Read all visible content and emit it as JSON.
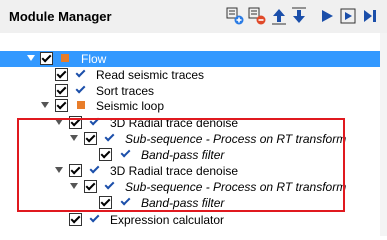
{
  "window": {
    "title": "Module Manager"
  },
  "toolbar": {
    "icons": [
      "add-module-icon",
      "remove-module-icon",
      "move-up-icon",
      "move-down-icon",
      "run-icon",
      "step-icon",
      "fast-forward-icon"
    ]
  },
  "tree": {
    "rows": [
      {
        "label": "Flow",
        "selected": true
      },
      {
        "label": "Read seismic traces"
      },
      {
        "label": "Sort traces"
      },
      {
        "label": "Seismic loop"
      },
      {
        "label": "3D Radial trace denoise"
      },
      {
        "label": "Sub-sequence - Process on RT transform"
      },
      {
        "label": "Band-pass filter"
      },
      {
        "label": "3D Radial trace denoise"
      },
      {
        "label": "Sub-sequence - Process on RT transform"
      },
      {
        "label": "Band-pass filter"
      },
      {
        "label": "Expression calculator"
      }
    ]
  },
  "colors": {
    "selection": "#3399ff",
    "highlight_box": "#e0191f",
    "loop_marker": "#e87d2a"
  }
}
